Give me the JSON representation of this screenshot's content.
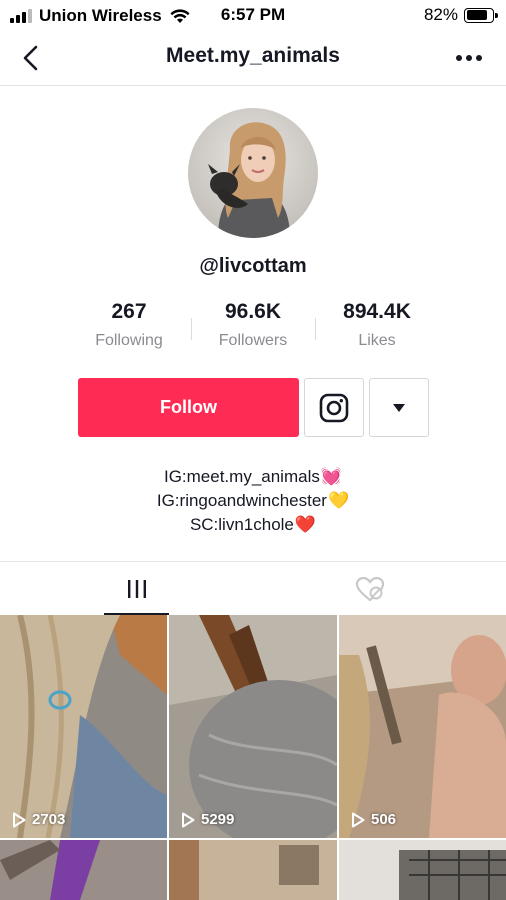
{
  "status": {
    "carrier": "Union Wireless",
    "time": "6:57 PM",
    "battery_percent": "82%",
    "battery_level": 0.82
  },
  "nav": {
    "title": "Meet.my_animals",
    "back_icon": "chevron-left-icon",
    "more_icon": "more-horizontal-icon"
  },
  "profile": {
    "username": "@livcottam",
    "stats": [
      {
        "value": "267",
        "label": "Following"
      },
      {
        "value": "96.6K",
        "label": "Followers"
      },
      {
        "value": "894.4K",
        "label": "Likes"
      }
    ],
    "follow_label": "Follow",
    "bio": [
      {
        "text": "IG:meet.my_animals",
        "emoji": "💓"
      },
      {
        "text": "IG:ringoandwinchester",
        "emoji": "💛"
      },
      {
        "text": "SC:livn1chole",
        "emoji": "❤️"
      }
    ]
  },
  "colors": {
    "accent": "#fe2c55",
    "text": "#161823",
    "muted": "#8a8b91"
  },
  "tabs": [
    {
      "icon": "video-grid-icon",
      "active": true
    },
    {
      "icon": "liked-heart-icon",
      "active": false
    }
  ],
  "videos": [
    {
      "views": "2703"
    },
    {
      "views": "5299"
    },
    {
      "views": "506"
    },
    {
      "views": ""
    },
    {
      "views": ""
    },
    {
      "views": ""
    }
  ]
}
